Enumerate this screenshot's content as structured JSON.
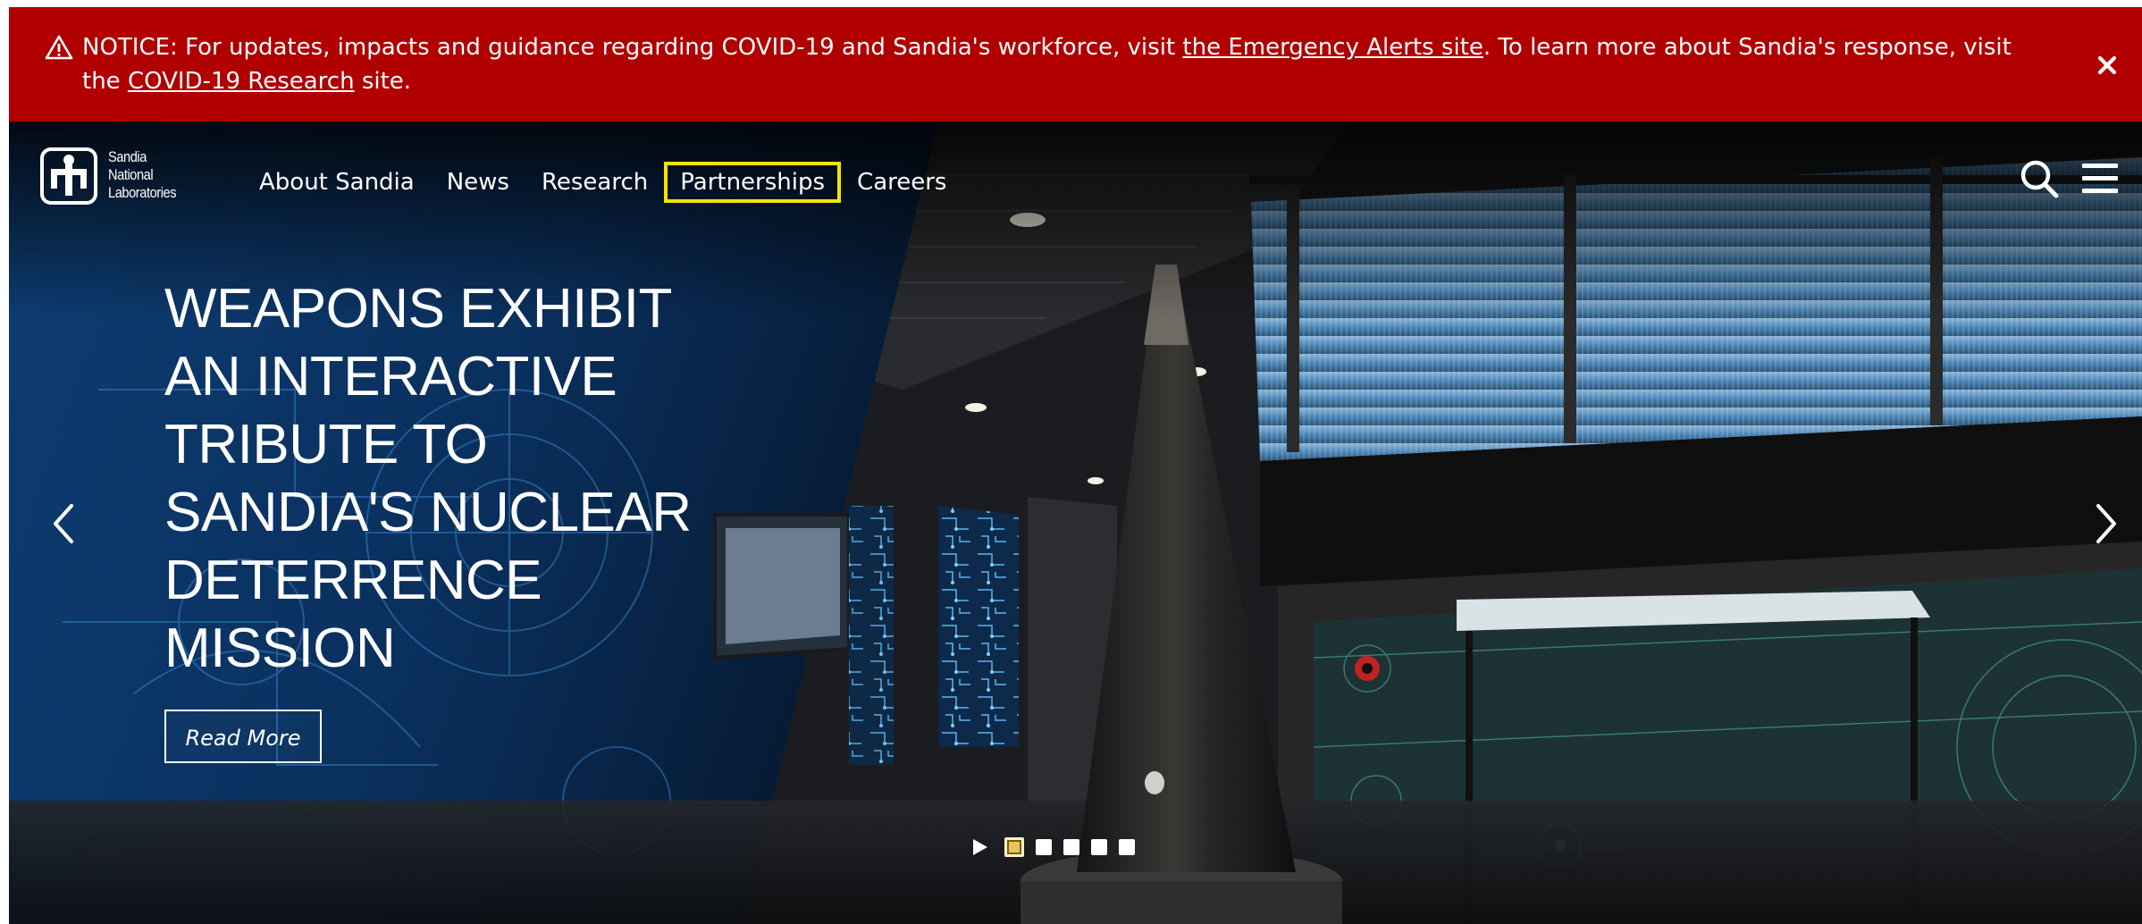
{
  "notice": {
    "prefix": "NOTICE: For updates, impacts and guidance regarding COVID-19 and Sandia's workforce, visit ",
    "link1": "the Emergency Alerts site",
    "middle": ". To learn more about Sandia's response, visit the ",
    "link2": "COVID-19 Research",
    "suffix": " site.",
    "background": "#b00000"
  },
  "logo": {
    "line1": "Sandia",
    "line2": "National",
    "line3": "Laboratories"
  },
  "nav": {
    "items": [
      {
        "label": "About Sandia"
      },
      {
        "label": "News"
      },
      {
        "label": "Research"
      },
      {
        "label": "Partnerships",
        "highlighted": true
      },
      {
        "label": "Careers"
      }
    ],
    "highlight_color": "#f2e400"
  },
  "slide": {
    "headline_lines": [
      "WEAPONS EXHIBIT",
      "AN INTERACTIVE",
      "TRIBUTE TO",
      "SANDIA'S NUCLEAR",
      "DETERRENCE",
      "MISSION"
    ],
    "button": "Read More"
  },
  "carousel": {
    "slide_count": 5,
    "active_index": 0
  },
  "icons": {
    "notice": "warning-icon",
    "close": "close-icon",
    "search": "search-icon",
    "menu": "hamburger-icon",
    "prev": "chevron-left-icon",
    "next": "chevron-right-icon",
    "play": "play-icon"
  }
}
